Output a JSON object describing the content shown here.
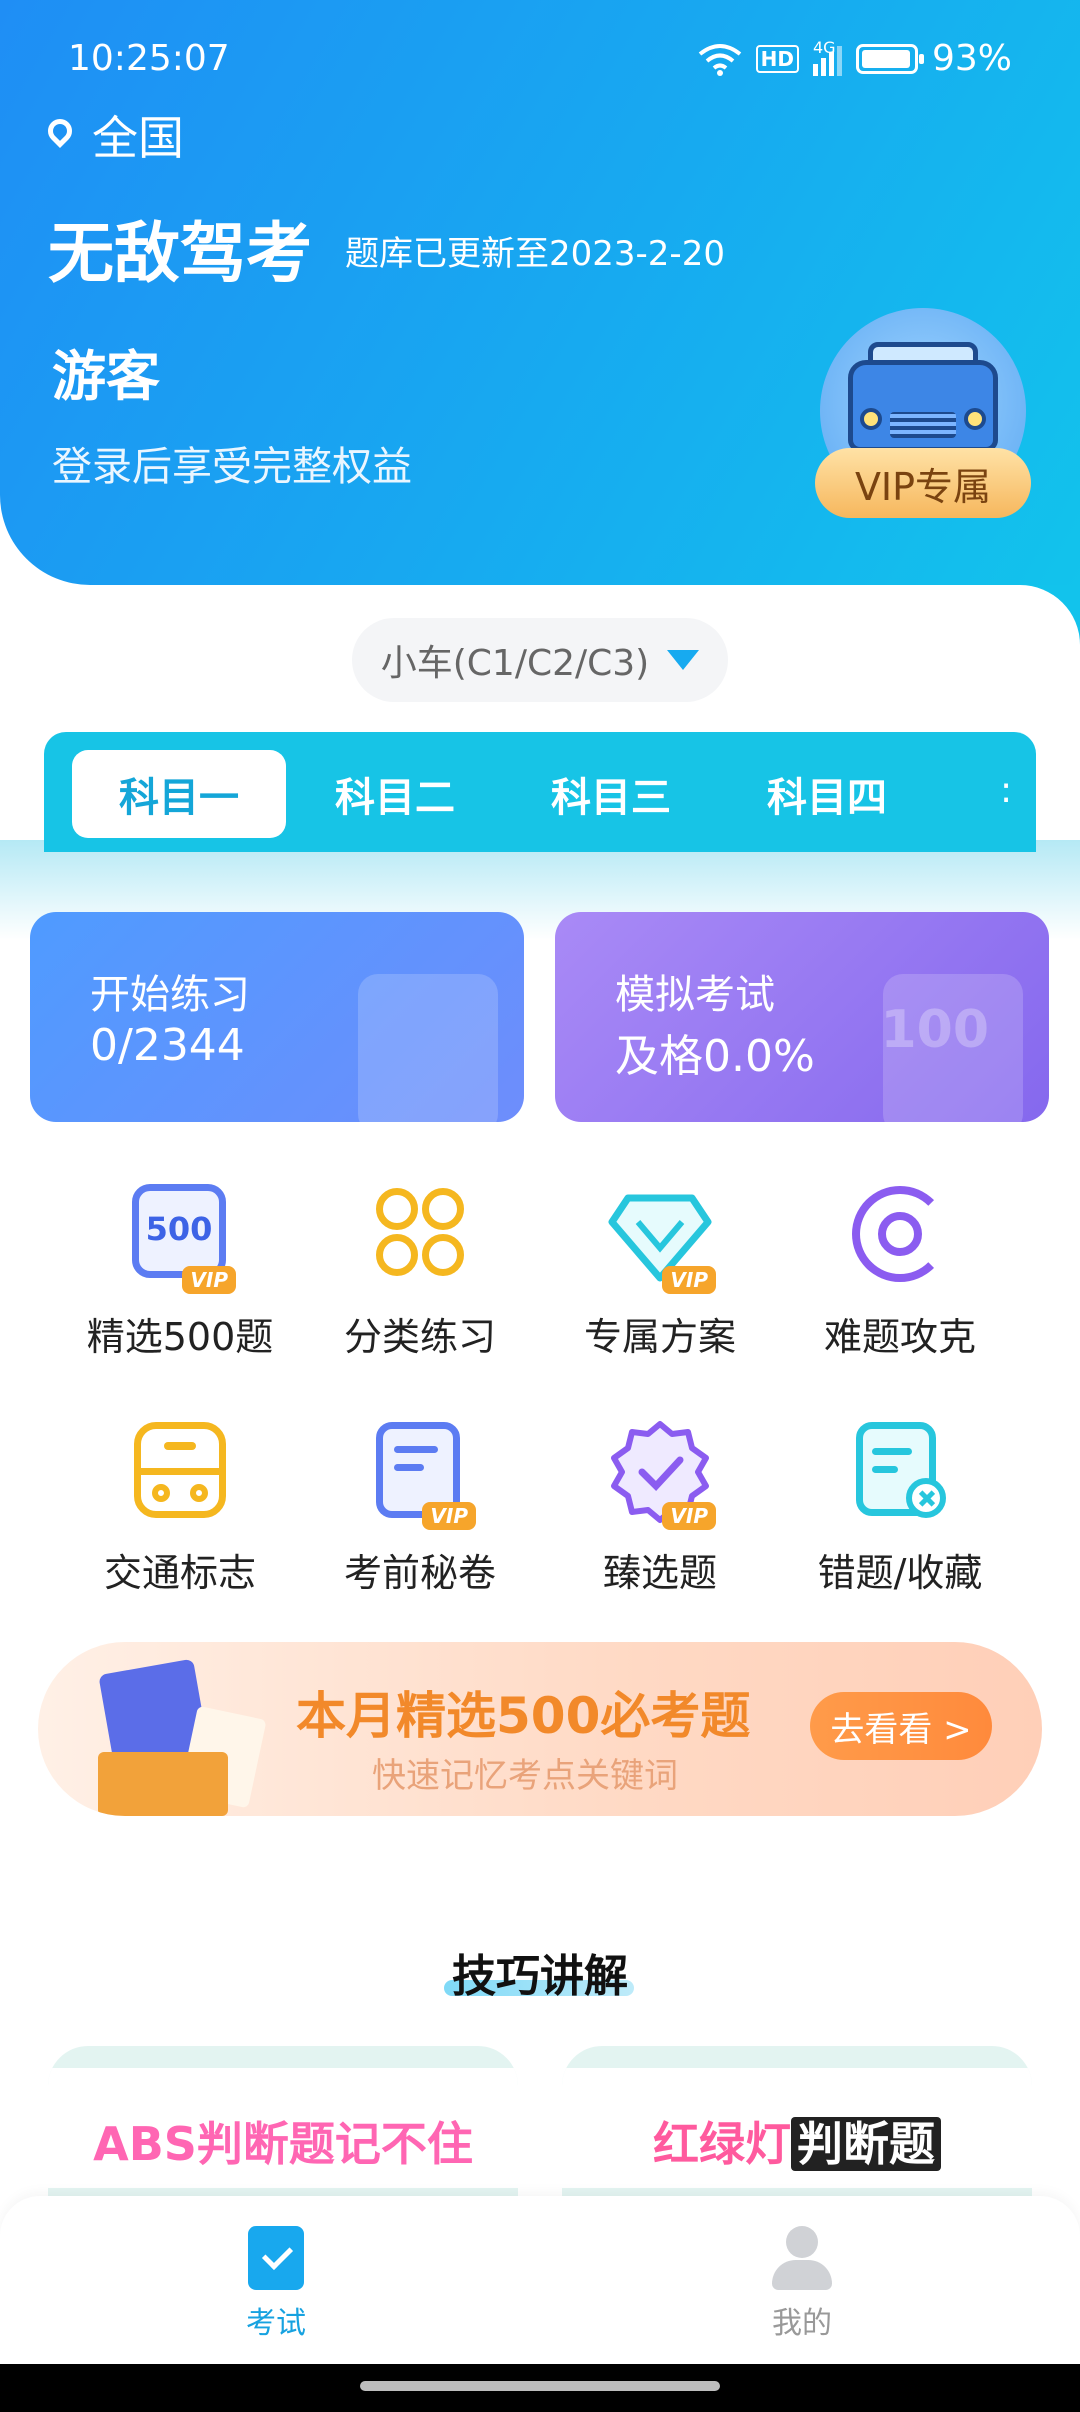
{
  "status_bar": {
    "time": "10:25:07",
    "hd_label": "HD",
    "network_label": "4G",
    "battery": "93%"
  },
  "header": {
    "location": "全国",
    "app_title": "无敌驾考",
    "update_text": "题库已更新至2023-2-20",
    "guest_label": "游客",
    "login_tip": "登录后享受完整权益",
    "vip_badge": "VIP专属"
  },
  "car_selector": {
    "value": "小车(C1/C2/C3)"
  },
  "tabs": [
    {
      "label": "科目一",
      "active": true
    },
    {
      "label": "科目二",
      "active": false
    },
    {
      "label": "科目三",
      "active": false
    },
    {
      "label": "科目四",
      "active": false
    }
  ],
  "tab_more": ":",
  "cards": {
    "practice": {
      "title": "开始练习",
      "value": "0/2344"
    },
    "mock": {
      "title": "模拟考试",
      "value": "及格0.0%",
      "deco": "100"
    }
  },
  "grid": [
    {
      "label": "精选500题",
      "icon": "selected-500-icon",
      "badge": "VIP",
      "icon_text": "500"
    },
    {
      "label": "分类练习",
      "icon": "category-icon"
    },
    {
      "label": "专属方案",
      "icon": "diamond-icon",
      "badge": "VIP"
    },
    {
      "label": "难题攻克",
      "icon": "target-icon"
    },
    {
      "label": "交通标志",
      "icon": "traffic-sign-icon"
    },
    {
      "label": "考前秘卷",
      "icon": "secret-paper-icon",
      "badge": "VIP"
    },
    {
      "label": "臻选题",
      "icon": "verified-badge-icon",
      "badge": "VIP"
    },
    {
      "label": "错题/收藏",
      "icon": "wrong-questions-icon"
    }
  ],
  "banner": {
    "title": "本月精选500必考题",
    "subtitle": "快速记忆考点关键词",
    "button": "去看看 >"
  },
  "tips": {
    "title": "技巧讲解",
    "left_card": "ABS判断题记不住",
    "right_card_a": "红绿灯",
    "right_card_b": "判断题"
  },
  "bottom_nav": [
    {
      "label": "考试",
      "active": true
    },
    {
      "label": "我的",
      "active": false
    }
  ],
  "colors": {
    "header_blue": "#1f8ef5",
    "tab_cyan": "#17c4e6",
    "accent_orange": "#f6a52b"
  }
}
